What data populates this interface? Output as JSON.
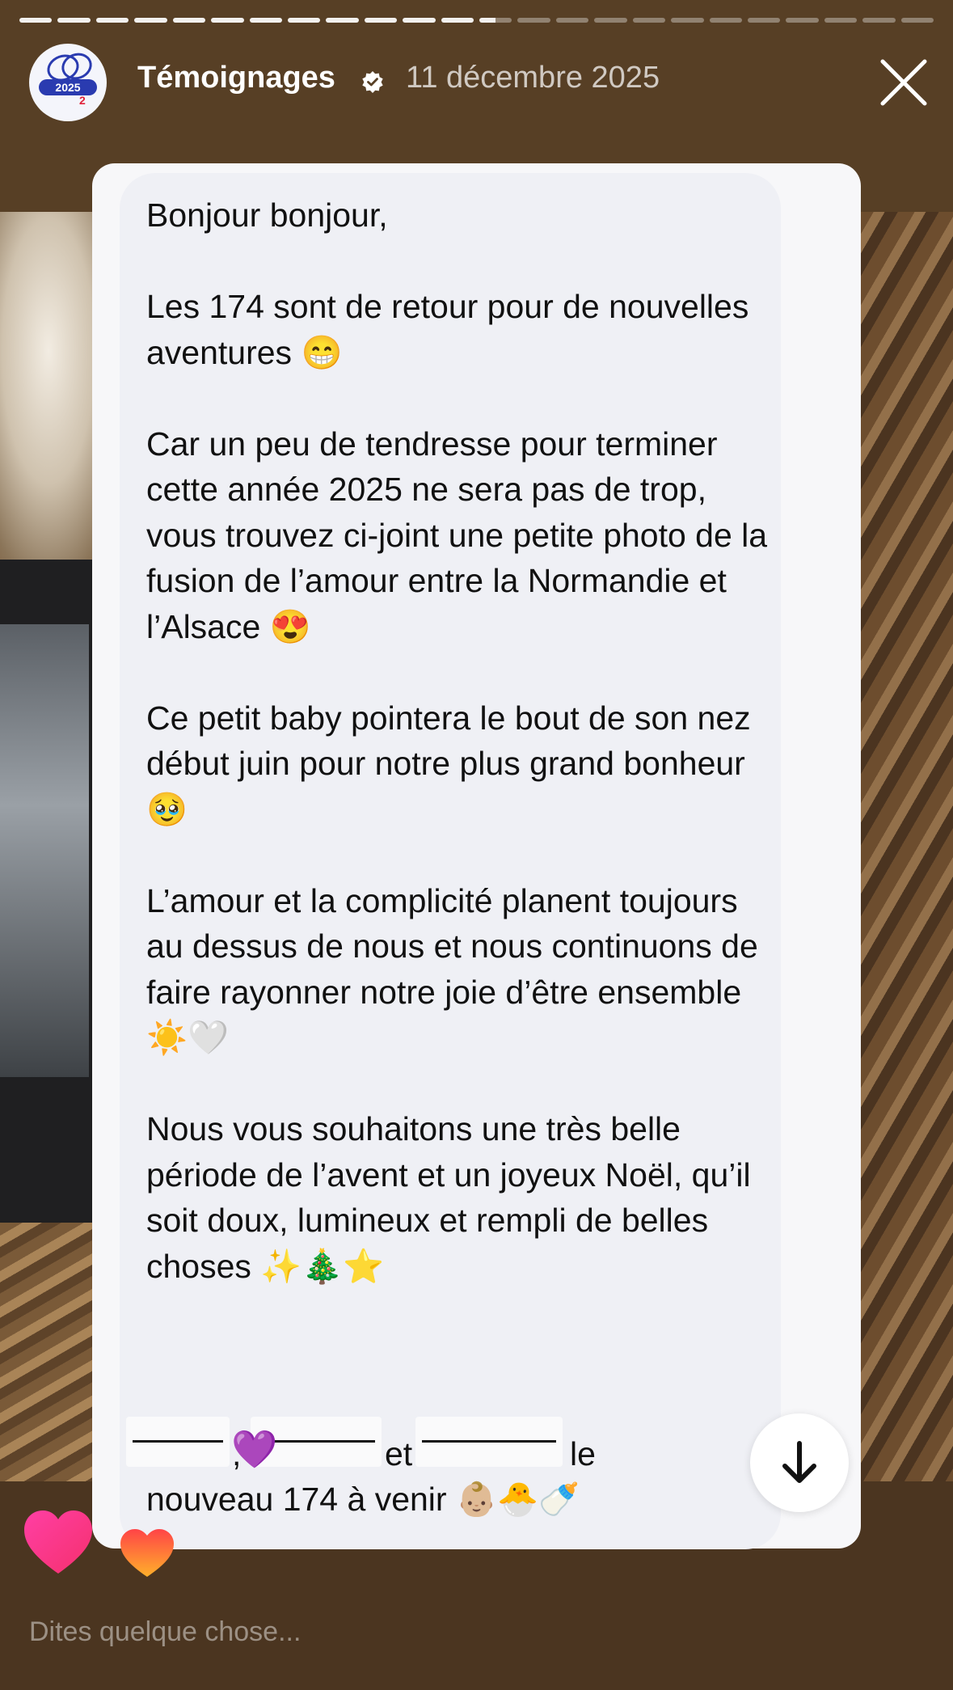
{
  "story": {
    "progress": {
      "total_segments": 24,
      "completed_segments": 12,
      "current_segment_fraction": 0.5
    },
    "account_name": "Témoignages",
    "verified": true,
    "post_date": "11 décembre 2025",
    "avatar": {
      "label_year": "2025",
      "label_small": "2"
    }
  },
  "message": {
    "paragraphs": [
      "Bonjour bonjour,",
      "Les 174 sont de retour pour de nouvelles aventures 😁",
      "Car un peu de tendresse pour terminer cette année 2025 ne sera pas de trop, vous trouvez ci-joint une petite photo de la fusion de l’amour entre la Normandie et l’Alsace 😍",
      "Ce petit baby pointera le bout de son nez début juin pour notre plus grand bonheur 🥹",
      "L’amour et la complicité planent toujours au dessus de nous et nous continuons de faire rayonner notre joie d’être ensemble ☀️🤍",
      "Nous vous souhaitons une très belle période de l’avent et un joyeux Noël, qu’il soit doux, lumineux et rempli de belles choses ✨🎄⭐"
    ],
    "signature": {
      "comma": ",",
      "et": "et",
      "le": "le",
      "heart": "💜",
      "last_line": "nouveau 174 à venir 👶🏼🐣🍼"
    }
  },
  "reply": {
    "placeholder": "Dites quelque chose..."
  },
  "colors": {
    "heart_gradient": [
      "#ff3b8e",
      "#f9437a"
    ],
    "small_heart": [
      "#ff4d4d",
      "#ffb52e"
    ]
  }
}
